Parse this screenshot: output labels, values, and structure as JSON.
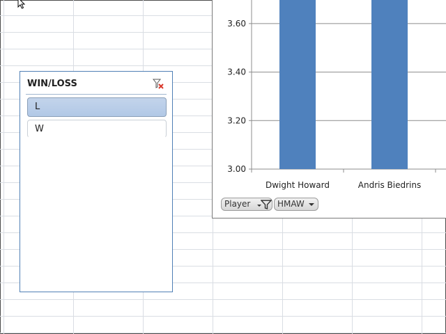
{
  "slicer": {
    "title": "WIN/LOSS",
    "items": [
      {
        "label": "L",
        "selected": true
      },
      {
        "label": "W",
        "selected": false
      }
    ]
  },
  "chart_data": {
    "type": "bar",
    "categories": [
      "Dwight Howard",
      "Andris Biedrins"
    ],
    "values": [
      3.7,
      3.7
    ],
    "ylim": [
      3.0,
      3.7
    ],
    "yticks": [
      "3.00",
      "3.20",
      "3.40",
      "3.60"
    ],
    "ytick_values": [
      3.0,
      3.2,
      3.4,
      3.6
    ],
    "grid": true,
    "bar_color": "#4f81bd"
  },
  "field_buttons": {
    "player": "Player",
    "hmaw": "HMAW"
  }
}
